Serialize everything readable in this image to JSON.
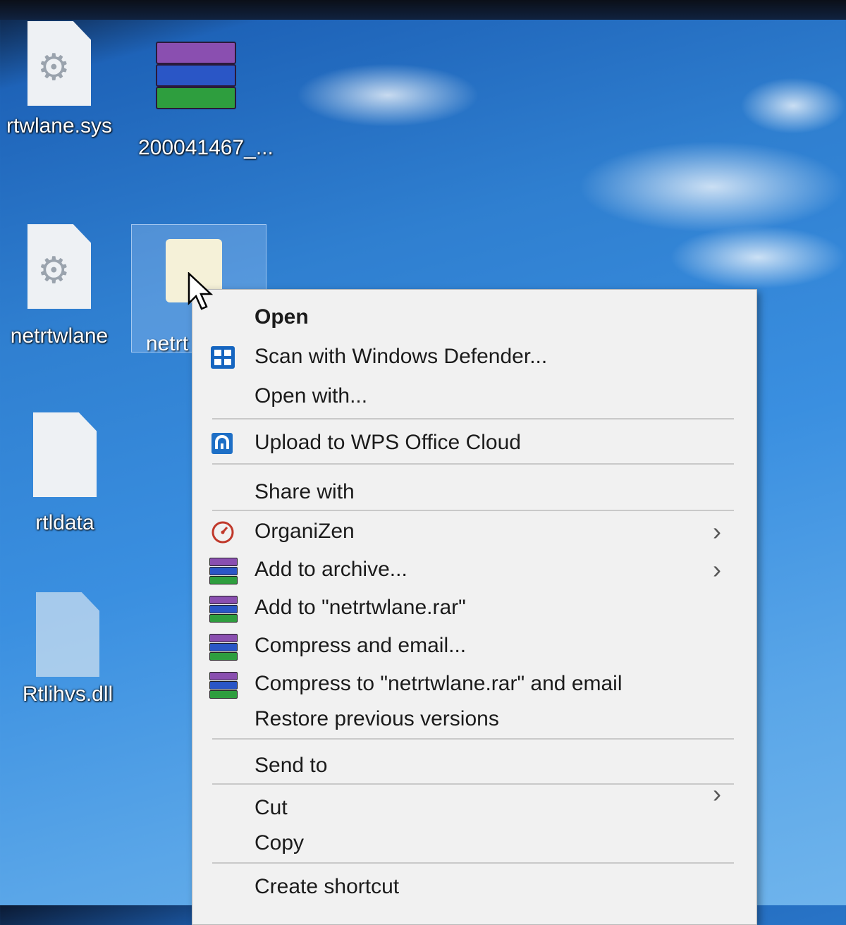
{
  "desktop": {
    "icons": [
      {
        "label": "rtwlane.sys"
      },
      {
        "label": "200041467_..."
      },
      {
        "label": "netrtwlane"
      },
      {
        "label": "netrt"
      },
      {
        "label": "rtldata"
      },
      {
        "label": "Rtlihvs.dll"
      }
    ]
  },
  "context_menu": {
    "items": [
      {
        "label": "Open",
        "icon": "none"
      },
      {
        "label": "Scan with Windows Defender...",
        "icon": "defender-shield-icon"
      },
      {
        "label": "Open with...",
        "icon": "none"
      },
      {
        "label": "Upload to WPS Office Cloud",
        "icon": "wps-cloud-icon"
      },
      {
        "label": "Share with",
        "icon": "none"
      },
      {
        "label": "OrganiZen",
        "icon": "organizen-icon",
        "submenu": true
      },
      {
        "label": "Add to archive...",
        "icon": "winrar-icon",
        "submenu": true
      },
      {
        "label": "Add to \"netrtwlane.rar\"",
        "icon": "winrar-icon"
      },
      {
        "label": "Compress and email...",
        "icon": "winrar-icon"
      },
      {
        "label": "Compress to \"netrtwlane.rar\" and email",
        "icon": "winrar-icon"
      },
      {
        "label": "Restore previous versions",
        "icon": "none"
      },
      {
        "label": "Send to",
        "icon": "none",
        "submenu": true
      },
      {
        "label": "Cut",
        "icon": "none"
      },
      {
        "label": "Copy",
        "icon": "none"
      },
      {
        "label": "Create shortcut",
        "icon": "none"
      }
    ],
    "submenu_arrow": "›"
  },
  "colors": {
    "menu_bg": "#f1f1f1",
    "defender_blue": "#1565c0",
    "organizen_red": "#c0392b"
  }
}
